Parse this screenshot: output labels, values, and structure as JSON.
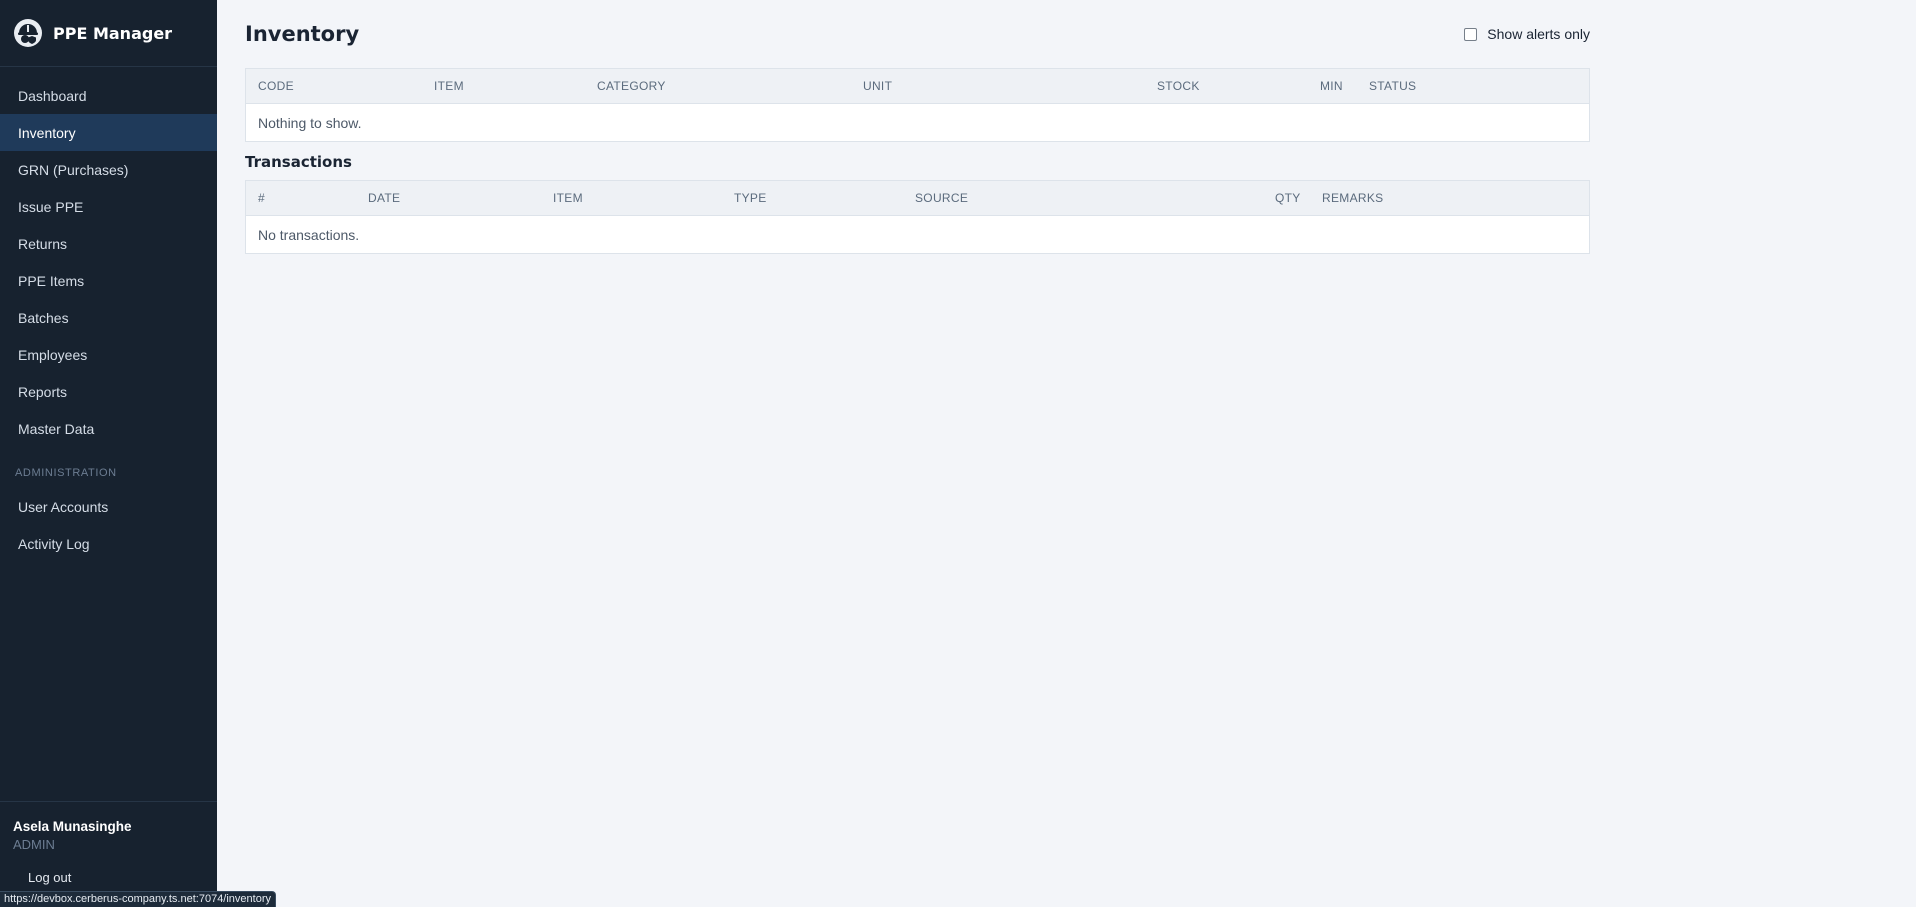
{
  "app": {
    "name": "PPE Manager",
    "logo_icon": "hardhat-shield-icon"
  },
  "sidebar": {
    "items": [
      {
        "label": "Dashboard"
      },
      {
        "label": "Inventory",
        "active": true
      },
      {
        "label": "GRN (Purchases)"
      },
      {
        "label": "Issue PPE"
      },
      {
        "label": "Returns"
      },
      {
        "label": "PPE Items"
      },
      {
        "label": "Batches"
      },
      {
        "label": "Employees"
      },
      {
        "label": "Reports"
      },
      {
        "label": "Master Data"
      }
    ],
    "admin_section_label": "ADMINISTRATION",
    "admin_items": [
      {
        "label": "User Accounts"
      },
      {
        "label": "Activity Log"
      }
    ],
    "user": {
      "name": "Asela Munasinghe",
      "role": "ADMIN",
      "logout_label": "Log out"
    }
  },
  "main": {
    "title": "Inventory",
    "alerts_toggle_label": "Show alerts only",
    "alerts_toggle_checked": false,
    "inventory_table": {
      "columns": [
        "CODE",
        "ITEM",
        "CATEGORY",
        "UNIT",
        "STOCK",
        "MIN",
        "STATUS"
      ],
      "empty_text": "Nothing to show."
    },
    "transactions_title": "Transactions",
    "transactions_table": {
      "columns": [
        "#",
        "DATE",
        "ITEM",
        "TYPE",
        "SOURCE",
        "QTY",
        "REMARKS"
      ],
      "empty_text": "No transactions."
    }
  },
  "status_bar": {
    "url": "https://devbox.cerberus-company.ts.net:7074/inventory"
  },
  "colors": {
    "sidebar_bg": "#17222f",
    "sidebar_active": "#1f3a5a",
    "page_bg": "#f3f5f9",
    "table_header_bg": "#eef1f5"
  }
}
